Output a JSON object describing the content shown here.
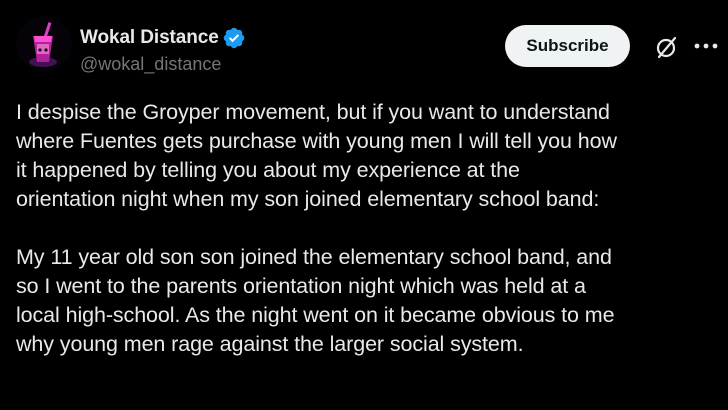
{
  "author": {
    "display_name": "Wokal Distance",
    "handle": "@wokal_distance",
    "verified": true,
    "verified_color": "#1d9bf0"
  },
  "actions": {
    "subscribe_label": "Subscribe",
    "grok_icon": "grok-icon",
    "more_icon": "more-horizontal-icon"
  },
  "tweet": {
    "paragraphs": [
      "I despise the Groyper movement, but if you want to understand\nwhere Fuentes gets purchase with young men I will tell you how\nit happened by telling you about my experience at the\norientation night when my son joined elementary school band:",
      "My 11 year old son son joined the elementary school band, and\nso I went to the parents orientation night which was held at a\nlocal high-school. As the night went on it became obvious to me\nwhy young men rage against the larger social system."
    ]
  },
  "colors": {
    "background": "#000000",
    "text_primary": "#e7e9ea",
    "text_secondary": "#71767b",
    "button_bg": "#eff3f4",
    "button_text": "#0f1419"
  }
}
